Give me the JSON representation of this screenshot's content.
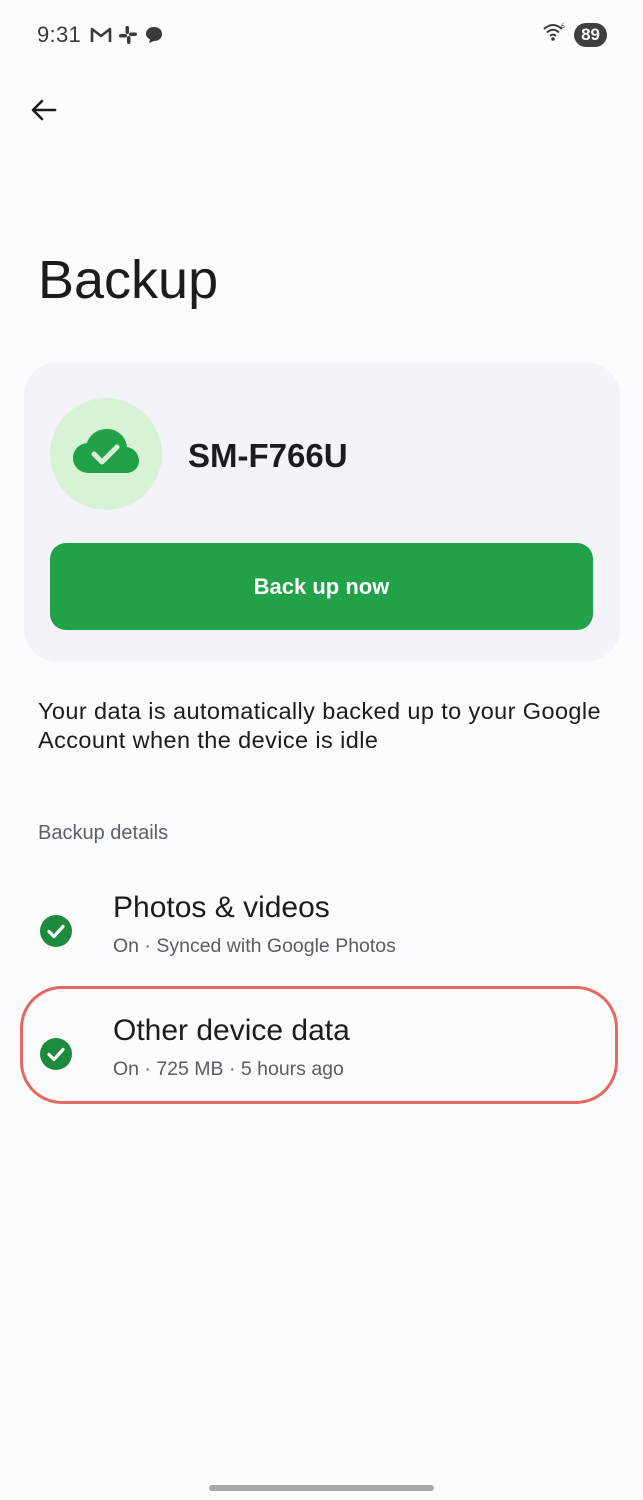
{
  "status_bar": {
    "time": "9:31",
    "left_icons": [
      "gmail-icon",
      "slack-icon",
      "chat-icon"
    ],
    "right_icons": [
      "wifi-icon"
    ],
    "battery_level": "89"
  },
  "header": {
    "back_icon": "arrow-back-icon"
  },
  "page": {
    "title": "Backup"
  },
  "device_card": {
    "icon": "cloud-check-icon",
    "device_name": "SM-F766U",
    "backup_button_label": "Back up now"
  },
  "description": "Your data is automatically backed up to your Google Account when the device is idle",
  "backup_details": {
    "section_label": "Backup details",
    "items": [
      {
        "icon": "check-circle-icon",
        "title": "Photos & videos",
        "subtitle": "On · Synced with Google Photos"
      },
      {
        "icon": "check-circle-icon",
        "title": "Other device data",
        "subtitle": "On · 725 MB · 5 hours ago",
        "highlighted": true
      }
    ]
  },
  "colors": {
    "accent_green": "#21a249",
    "icon_bg_green": "#d8f2d5",
    "check_green": "#1e8a3e",
    "highlight_red": "#e5675e",
    "card_bg": "#f4f3fa"
  }
}
